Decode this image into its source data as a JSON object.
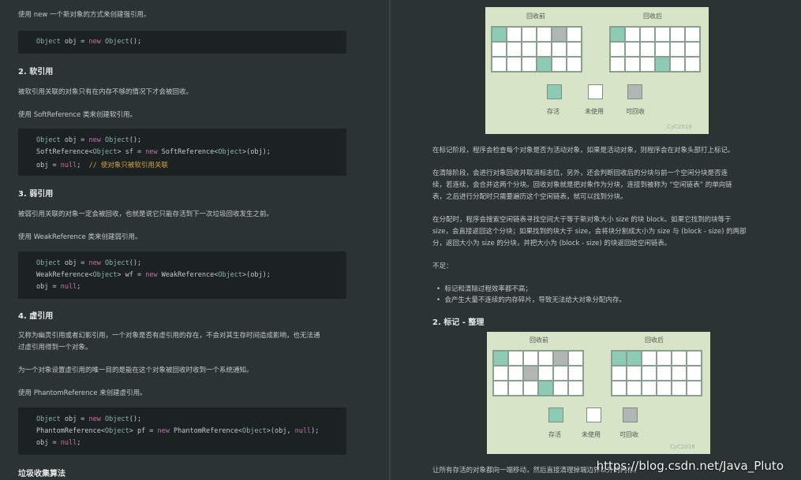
{
  "left": {
    "intro": "使用 new 一个新对象的方式来创建强引用。",
    "code1": [
      "Object obj = new Object();"
    ],
    "h_soft": "2. 软引用",
    "soft_p1": "被软引用关联的对象只有在内存不够的情况下才会被回收。",
    "soft_p2": "使用 SoftReference 类来创建软引用。",
    "code2": [
      "Object obj = new Object();",
      "SoftReference<Object> sf = new SoftReference<Object>(obj);",
      "obj = null;  // 使对象只被软引用关联"
    ],
    "h_weak": "3. 弱引用",
    "weak_p1": "被弱引用关联的对象一定会被回收，也就是说它只能存活到下一次垃圾回收发生之前。",
    "weak_p2": "使用 WeakReference 类来创建弱引用。",
    "code3": [
      "Object obj = new Object();",
      "WeakReference<Object> wf = new WeakReference<Object>(obj);",
      "obj = null;"
    ],
    "h_phantom": "4. 虚引用",
    "ph_p1a": "又称为幽灵引用或者幻影引用，一个对象是否有虚引用的存在，不会对其生存时间造成影响，也无法通",
    "ph_p1b": "过虚引用得到一个对象。",
    "ph_p2": "为一个对象设置虚引用的唯一目的是能在这个对象被回收时收到一个系统通知。",
    "ph_p3": "使用 PhantomReference 来创建虚引用。",
    "code4": [
      "Object obj = new Object();",
      "PhantomReference<Object> pf = new PhantomReference<Object>(obj, null);",
      "obj = null;"
    ],
    "h_gc": "垃圾收集算法"
  },
  "diagram1": {
    "before": "回收前",
    "after": "回收后",
    "before_cells": [
      "a",
      "w",
      "w",
      "w",
      "r",
      "w",
      "w",
      "w",
      "w",
      "w",
      "w",
      "w",
      "w",
      "w",
      "w",
      "a",
      "w",
      "w"
    ],
    "after_cells": [
      "a",
      "w",
      "w",
      "w",
      "w",
      "w",
      "w",
      "w",
      "w",
      "w",
      "w",
      "w",
      "w",
      "w",
      "w",
      "a",
      "w",
      "w"
    ],
    "legend": [
      "存活",
      "未使用",
      "可回收"
    ],
    "credit": "CyC2018"
  },
  "right": {
    "mark_p": "在标记阶段，程序会检查每个对象是否为活动对象，如果是活动对象，则程序会在对象头部打上标记。",
    "sweep_p1": "在清除阶段，会进行对象回收并取消标志位，另外，还会判断回收后的分块与前一个空闲分块是否连",
    "sweep_p2": "续，若连续，会合并这两个分块。回收对象就是把对象作为分块，连接到被称为 “空闲链表” 的单向链",
    "sweep_p3": "表，之后进行分配时只需要遍历这个空闲链表，就可以找到分块。",
    "alloc_p1": "在分配时，程序会搜索空闲链表寻找空间大于等于新对象大小 size 的块 block。如果它找到的块等于",
    "alloc_p2": "size，会直接返回这个分块；如果找到的块大于 size，会将块分割成大小为 size 与 (block - size) 的两部",
    "alloc_p3": "分，返回大小为 size 的分块，并把大小为 (block - size) 的块返回给空闲链表。",
    "cons": "不足：",
    "bullet1": "标记和清除过程效率都不高；",
    "bullet2": "会产生大量不连续的内存碎片，导致无法给大对象分配内存。",
    "h_compact": "2. 标记 - 整理",
    "bottom": "让所有存活的对象都向一端移动，然后直接清理掉端边界以外的内存。"
  },
  "diagram2": {
    "before": "回收前",
    "after": "回收后",
    "before_cells": [
      "a",
      "w",
      "w",
      "w",
      "r",
      "w",
      "w",
      "w",
      "r",
      "w",
      "w",
      "w",
      "w",
      "w",
      "w",
      "a",
      "w",
      "w"
    ],
    "after_cells": [
      "a",
      "a",
      "w",
      "w",
      "w",
      "w",
      "w",
      "w",
      "w",
      "w",
      "w",
      "w",
      "w",
      "w",
      "w",
      "w",
      "w",
      "w"
    ],
    "legend": [
      "存活",
      "未使用",
      "可回收"
    ],
    "credit": "CyC2018"
  },
  "watermark": "https://blog.csdn.net/Java_Pluto"
}
